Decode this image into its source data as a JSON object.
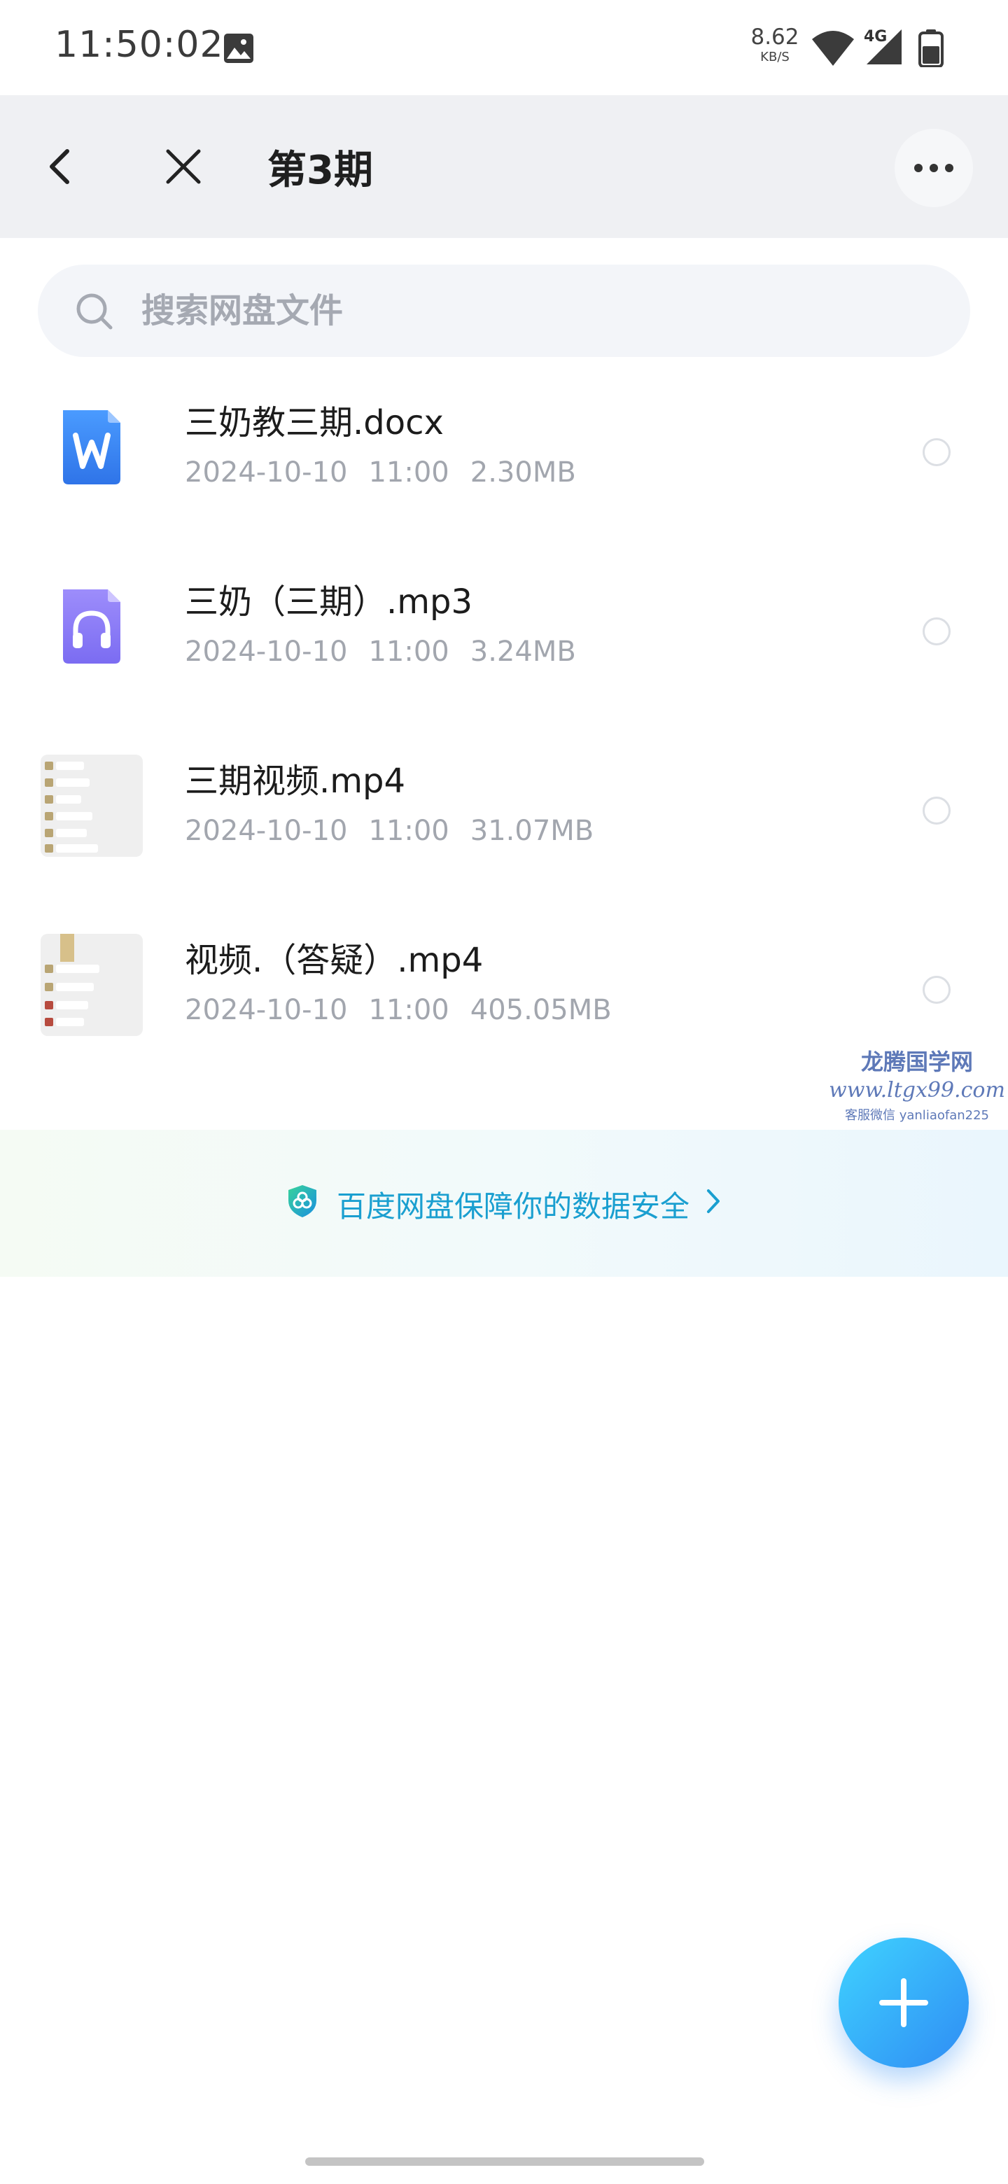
{
  "status_bar": {
    "time": "11:50:02",
    "net_speed_value": "8.62",
    "net_speed_unit": "KB/S",
    "network_type": "4G",
    "icons": [
      "gallery-icon",
      "wifi-icon",
      "signal-icon",
      "battery-icon"
    ]
  },
  "header": {
    "title": "第3期",
    "back_icon": "back-icon",
    "close_icon": "close-icon",
    "more_icon": "more-icon"
  },
  "search": {
    "placeholder": "搜索网盘文件",
    "value": ""
  },
  "files": [
    {
      "name": "三奶教三期.docx",
      "date": "2024-10-10",
      "time": "11:00",
      "size": "2.30MB",
      "type": "docx",
      "icon": "word-doc-icon",
      "selected": false
    },
    {
      "name": "三奶（三期）.mp3",
      "date": "2024-10-10",
      "time": "11:00",
      "size": "3.24MB",
      "type": "mp3",
      "icon": "audio-file-icon",
      "selected": false
    },
    {
      "name": "三期视频.mp4",
      "date": "2024-10-10",
      "time": "11:00",
      "size": "31.07MB",
      "type": "mp4",
      "icon": "video-thumbnail",
      "selected": false
    },
    {
      "name": "视频.（答疑）.mp4",
      "date": "2024-10-10",
      "time": "11:00",
      "size": "405.05MB",
      "type": "mp4",
      "icon": "video-thumbnail",
      "selected": false
    }
  ],
  "watermark": {
    "title": "龙腾国学网",
    "url": "www.ltgx99.com",
    "wechat": "客服微信 yanliaofan225"
  },
  "security_banner": {
    "text": "百度网盘保障你的数据安全",
    "icon": "shield-icon",
    "arrow_icon": "chevron-right-icon"
  },
  "fab": {
    "icon": "plus-icon"
  },
  "colors": {
    "accent": "#1a9fd0",
    "fab_start": "#3fd3ff",
    "fab_end": "#2f8cf4",
    "word_blue": "#3b82f0",
    "audio_purple": "#8b7cf6",
    "meta_gray": "#a2a6ae"
  }
}
